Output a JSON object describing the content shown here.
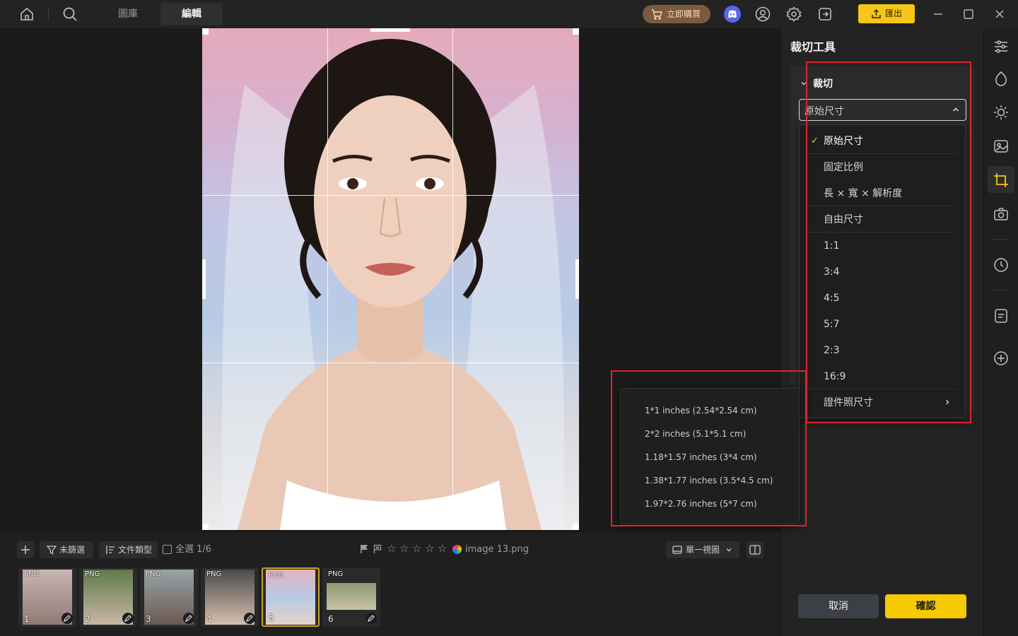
{
  "topbar": {
    "tabs": [
      {
        "label": "圖庫",
        "active": false
      },
      {
        "label": "編輯",
        "active": true
      }
    ],
    "buy_label": "立即購買",
    "export_label": "匯出",
    "icons": [
      "home-icon",
      "search-icon",
      "cart-icon",
      "discord-icon",
      "account-icon",
      "settings-icon",
      "login-icon",
      "upload-icon",
      "minimize-icon",
      "maximize-icon",
      "close-icon"
    ]
  },
  "panel": {
    "title": "裁切工具",
    "section_title": "裁切",
    "select_value": "原始尺寸",
    "options": [
      {
        "label": "原始尺寸",
        "selected": true
      },
      {
        "label": "固定比例",
        "selected": false
      },
      {
        "label": "長 × 寬 × 解析度",
        "selected": false
      },
      {
        "label": "自由尺寸",
        "selected": false
      },
      {
        "label": "1:1",
        "selected": false
      },
      {
        "label": "3:4",
        "selected": false
      },
      {
        "label": "4:5",
        "selected": false
      },
      {
        "label": "5:7",
        "selected": false
      },
      {
        "label": "2:3",
        "selected": false
      },
      {
        "label": "16:9",
        "selected": false
      },
      {
        "label": "證件照尺寸",
        "selected": false,
        "has_submenu": true
      }
    ],
    "submenu": [
      "1*1 inches (2.54*2.54 cm)",
      "2*2 inches (5.1*5.1 cm)",
      "1.18*1.57 inches (3*4 cm)",
      "1.38*1.77 inches (3.5*4.5 cm)",
      "1.97*2.76 inches (5*7 cm)"
    ],
    "cancel_label": "取消",
    "confirm_label": "確認"
  },
  "right_toolbar": {
    "icons": [
      "adjust-sliders-icon",
      "drop-icon",
      "brightness-icon",
      "image-effects-icon",
      "crop-icon",
      "camera-icon",
      "history-icon",
      "notes-icon",
      "add-icon"
    ],
    "active": "crop-icon"
  },
  "bottom": {
    "filter_label": "未篩選",
    "type_label": "文件類型",
    "select_all_label": "全選 1/6",
    "filename": "image 13.png",
    "view_label": "單一視圖",
    "thumbnails": [
      {
        "tag": "PNG",
        "num": "1",
        "selected": false
      },
      {
        "tag": "PNG",
        "num": "2",
        "selected": false
      },
      {
        "tag": "PNG",
        "num": "3",
        "selected": false
      },
      {
        "tag": "PNG",
        "num": "4",
        "selected": false
      },
      {
        "tag": "PNG",
        "num": "5",
        "selected": true
      },
      {
        "tag": "PNG",
        "num": "6",
        "selected": false
      }
    ]
  },
  "colors": {
    "accent": "#f5c518",
    "highlight_box": "#e0242e",
    "buy_button": "#7c5a3d"
  }
}
